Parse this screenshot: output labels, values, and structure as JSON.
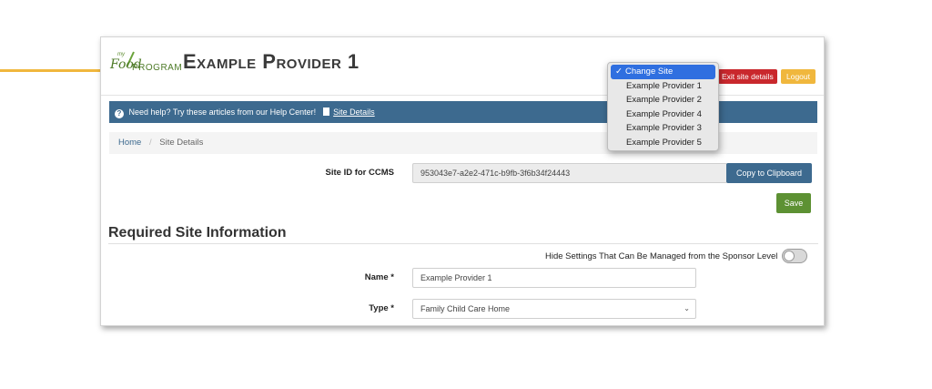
{
  "logo": {
    "my": "my",
    "food": "Food",
    "program": "PROGRAM"
  },
  "header": {
    "provider_name": "Example Provider 1",
    "exit_label": "Exit site details",
    "logout_label": "Logout"
  },
  "helpbar": {
    "text": "Need help? Try these articles from our Help Center!",
    "link": "Site Details"
  },
  "breadcrumb": {
    "home": "Home",
    "separator": "/",
    "current": "Site Details"
  },
  "site_id": {
    "label": "Site ID for CCMS",
    "value": "953043e7-a2e2-471c-b9fb-3f6b34f24443",
    "copy_label": "Copy to Clipboard"
  },
  "save_label": "Save",
  "section": {
    "title": "Required Site Information",
    "hide_label": "Hide Settings That Can Be Managed from the Sponsor Level"
  },
  "name_field": {
    "label": "Name *",
    "value": "Example Provider 1"
  },
  "type_field": {
    "label": "Type *",
    "value": "Family Child Care Home"
  },
  "dropdown": {
    "checkmark": "✓",
    "items": [
      "Change Site",
      "Example Provider 1",
      "Example Provider 2",
      "Example Provider 4",
      "Example Provider 3",
      "Example Provider 5"
    ]
  },
  "colors": {
    "accent_blue": "#3d6a8f",
    "danger": "#c9282d",
    "warning": "#f0b73d",
    "success": "#5d9133",
    "select_blue": "#2f6fe0"
  }
}
